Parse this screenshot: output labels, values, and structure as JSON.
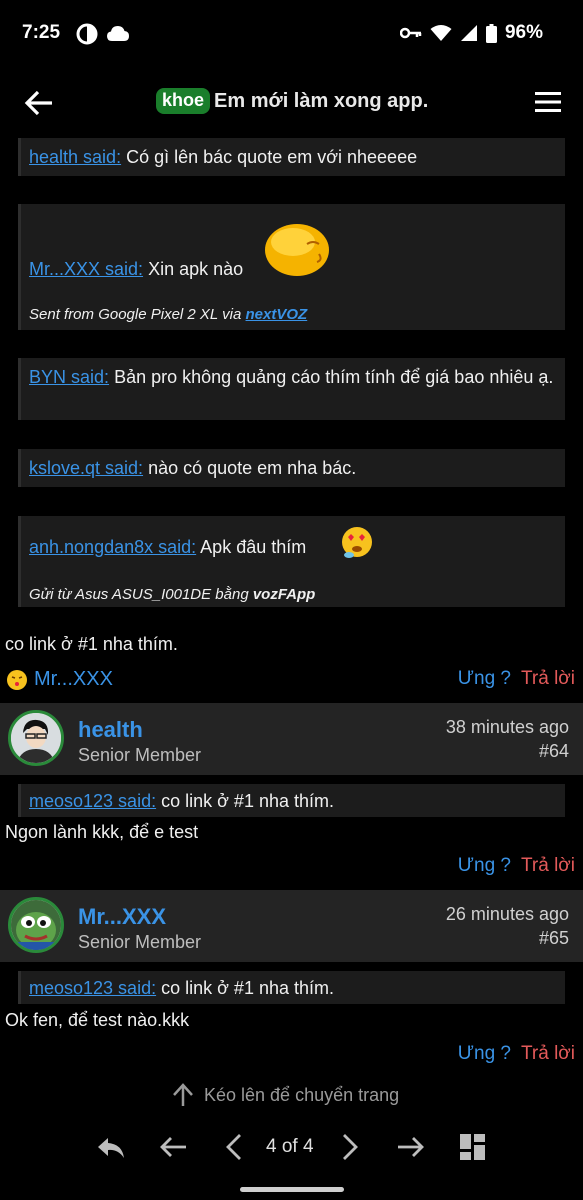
{
  "status_bar": {
    "time": "7:25",
    "battery": "96%",
    "icons": [
      "circle-half-icon",
      "cloud-icon",
      "vpn-key-icon",
      "wifi-icon",
      "signal-icon",
      "battery-icon"
    ]
  },
  "app_bar": {
    "tag": "khoe",
    "title": "Em mới làm xong app.",
    "tag_color": "#1a7e2b"
  },
  "quotes_top": [
    {
      "author": "health said:",
      "text": "Có gì lên bác quote em với nheeeee"
    },
    {
      "author": "Mr...XXX said:",
      "text": "Xin apk nào",
      "signature_prefix": "Sent from Google Pixel 2 XL via ",
      "signature_link": "nextVOZ"
    },
    {
      "author": "BYN said:",
      "text": "Bản pro không quảng cáo thím tính để giá bao nhiêu ạ."
    },
    {
      "author": "kslove.qt said:",
      "text": "nào có quote em nha bác."
    },
    {
      "author": "anh.nongdan8x said:",
      "text": "Apk đâu thím",
      "signature_prefix": "Gửi từ Asus ASUS_I001DE bằng ",
      "signature_link": "vozFApp"
    }
  ],
  "post_63": {
    "body": "co link ở #1 nha thím.",
    "reacted_by": "Mr...XXX",
    "like_label": "Ưng ?",
    "reply_label": "Trả lời"
  },
  "post_64": {
    "username": "health",
    "role": "Senior Member",
    "time": "38 minutes ago",
    "number": "#64",
    "quote_author": "meoso123 said:",
    "quote_text": "co link ở #1 nha thím.",
    "body": "Ngon lành kkk, để e test",
    "like_label": "Ưng ?",
    "reply_label": "Trả lời"
  },
  "post_65": {
    "username": "Mr...XXX",
    "role": "Senior Member",
    "time": "26 minutes ago",
    "number": "#65",
    "quote_author": "meoso123 said:",
    "quote_text": "co link ở #1 nha thím.",
    "body": "Ok fen, để test nào.kkk",
    "like_label": "Ưng ?",
    "reply_label": "Trả lời"
  },
  "footer": {
    "pull_hint": "Kéo lên để chuyển trang",
    "page_indicator": "4 of 4"
  }
}
